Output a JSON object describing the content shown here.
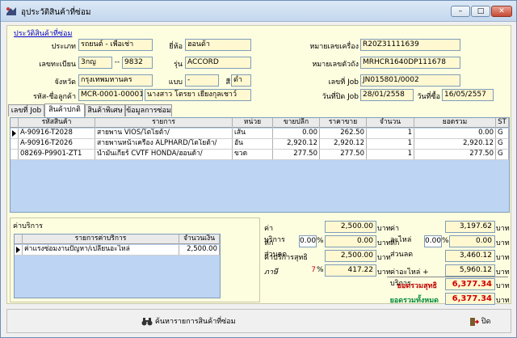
{
  "window": {
    "title": "อุประวัติสินค้าที่ซ่อม",
    "btn_min": "–",
    "btn_max": "□",
    "btn_close": "✕"
  },
  "header_link": "ประวัติสินค้าที่ซ่อม",
  "labels": {
    "vehicle_type": "ประเภท",
    "brand": "ยี่ห้อ",
    "engine_no": "หมายเลขเครื่อง",
    "plate_no": "เลขทะเบียน",
    "model": "รุ่น",
    "chassis_no": "หมายเลขตัวถัง",
    "province": "จังหวัด",
    "type": "แบบ",
    "color": "สี",
    "job_no": "เลขที่ Job",
    "customer": "รหัส-ชื่อลูกค้า",
    "job_close_date": "วันที่ปิด Job",
    "buy_date": "วันที่ซื้อ"
  },
  "fields": {
    "vehicle_type": "รถยนต์ - เพื่อเช่า",
    "brand": "ฮอนด้า",
    "engine_no": "R20Z31111639",
    "plate_prefix": "3กญ",
    "plate_sep": "--",
    "plate_number": "9832",
    "model": "ACCORD",
    "chassis_no": "MRHCR1640DP111678",
    "province": "กรุงเทพมหานคร",
    "type": "-",
    "color": "ดำ",
    "job_no": "JN015801/0002",
    "customer_code": "MCR-0001-00001",
    "customer_name": "นางสาว โตรยา เยียงกุลเชาว์",
    "job_close_date": "28/01/2558",
    "buy_date": "16/05/2557"
  },
  "tabs": [
    {
      "label": "เลขที่ Job"
    },
    {
      "label": "สินค้าปกติ"
    },
    {
      "label": "สินค้าพิเศษ"
    },
    {
      "label": "ข้อมูลการซ่อม"
    }
  ],
  "parts_table": {
    "columns": [
      "รหัสสินค้า",
      "รายการ",
      "หน่วย",
      "ขายปลีก",
      "ราคาขาย",
      "จำนวน",
      "ยอดรวม",
      "ST"
    ],
    "rows": [
      [
        "A-90916-T2028",
        "สายพาน VIOS/โตโยต้า/",
        "เส้น",
        "0.00",
        "262.50",
        "1",
        "0.00",
        "G"
      ],
      [
        "A-90916-T2026",
        "สายพานหน้าเครื่อง ALPHARD/โตโยต้า/",
        "อัน",
        "2,920.12",
        "2,920.12",
        "1",
        "2,920.12",
        "G"
      ],
      [
        "08269-P9901-ZT1",
        "น้ำมันเกียร์ CVTF HONDA/ฮอนด้า/",
        "ขวด",
        "277.50",
        "277.50",
        "1",
        "277.50",
        "G"
      ]
    ]
  },
  "service": {
    "box_title": "ค่าบริการ",
    "columns": [
      "รายการค่าบริการ",
      "จำนวนเงิน"
    ],
    "rows": [
      [
        "ค่าแรงซ่อมงานปัญหา/เปลี่ยนอะไหล่",
        "2,500.00"
      ]
    ]
  },
  "summary": {
    "service_fee_label": "ค่าบริการ",
    "service_fee": "2,500.00",
    "parts_fee_label": "ค่าอะไหล่",
    "parts_fee": "3,197.62",
    "discount_label": "หัก ส่วนลด",
    "svc_disc_pct": "0.00",
    "svc_disc_amt": "0.00",
    "parts_disc_pct": "0.00",
    "parts_disc_amt": "0.00",
    "pct": "%",
    "baht": "บาท",
    "service_net_label": "ค่าบริการสุทธิ",
    "service_net": "2,500.00",
    "parts_net": "3,460.12",
    "vat_label": "ภาษี",
    "vat_rate": "7",
    "vat_amt": "417.22",
    "parts_plus_service_label": "ค่าอะไหล่ + บริการ",
    "parts_plus_service": "5,960.12",
    "net_total_label": "ยอดรวมสุทธิ",
    "net_total": "6,377.34",
    "grand_total_label": "ยอดรวมทั้งหมด",
    "grand_total": "6,377.34"
  },
  "footer": {
    "search_button": "ค้นหารายการสินค้าที่ซ่อม",
    "close_button": "ปิด"
  }
}
